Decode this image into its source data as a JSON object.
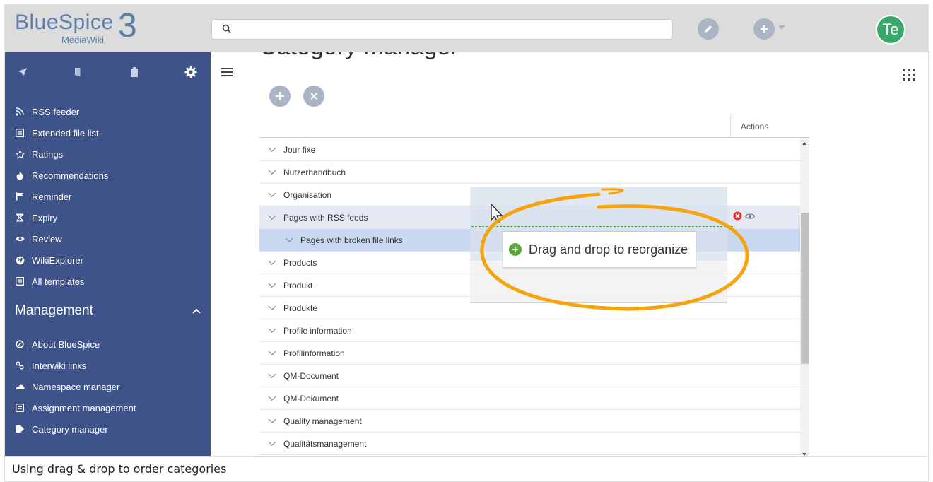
{
  "header": {
    "logo_text": "BlueSpice",
    "logo_sub": "MediaWiki",
    "logo_num": "3",
    "search_placeholder": "",
    "avatar_initials": "Te"
  },
  "sidebar": {
    "tabs": [
      "navigation-icon",
      "pages-icon",
      "clipboard-icon",
      "gear-icon"
    ],
    "items": [
      {
        "label": "RSS feeder",
        "icon": "rss-icon"
      },
      {
        "label": "Extended file list",
        "icon": "list-icon"
      },
      {
        "label": "Ratings",
        "icon": "star-icon"
      },
      {
        "label": "Recommendations",
        "icon": "flame-icon"
      },
      {
        "label": "Reminder",
        "icon": "flag-icon"
      },
      {
        "label": "Expiry",
        "icon": "hourglass-icon"
      },
      {
        "label": "Review",
        "icon": "eye-icon"
      },
      {
        "label": "WikiExplorer",
        "icon": "globe-icon"
      },
      {
        "label": "All templates",
        "icon": "list-icon"
      }
    ],
    "management_heading": "Management",
    "management_items": [
      {
        "label": "About BlueSpice",
        "icon": "circle-check-icon"
      },
      {
        "label": "Interwiki links",
        "icon": "link-icon"
      },
      {
        "label": "Namespace manager",
        "icon": "cloud-icon"
      },
      {
        "label": "Assignment management",
        "icon": "assignment-icon"
      },
      {
        "label": "Category manager",
        "icon": "tag-icon"
      }
    ]
  },
  "main": {
    "title": "Category manager",
    "grid_header_actions": "Actions",
    "rows": [
      {
        "label": "Jour fixe"
      },
      {
        "label": "Nutzerhandbuch"
      },
      {
        "label": "Organisation"
      },
      {
        "label": "Pages with RSS feeds"
      },
      {
        "label": "Pages with broken file links"
      },
      {
        "label": "Products"
      },
      {
        "label": "Produkt"
      },
      {
        "label": "Produkte"
      },
      {
        "label": "Profile information"
      },
      {
        "label": "Profilinformation"
      },
      {
        "label": "QM-Document"
      },
      {
        "label": "QM-Dokument"
      },
      {
        "label": "Quality management"
      },
      {
        "label": "Qualitätsmanagement"
      }
    ],
    "drag_tooltip": "Drag and drop to reorganize"
  },
  "caption": "Using drag & drop to order categories",
  "colors": {
    "sidebar_bg": "#3e5389",
    "topbar_bg": "#dcdcdc",
    "accent": "#f6a40d",
    "avatar_bg": "#3aa86b"
  }
}
